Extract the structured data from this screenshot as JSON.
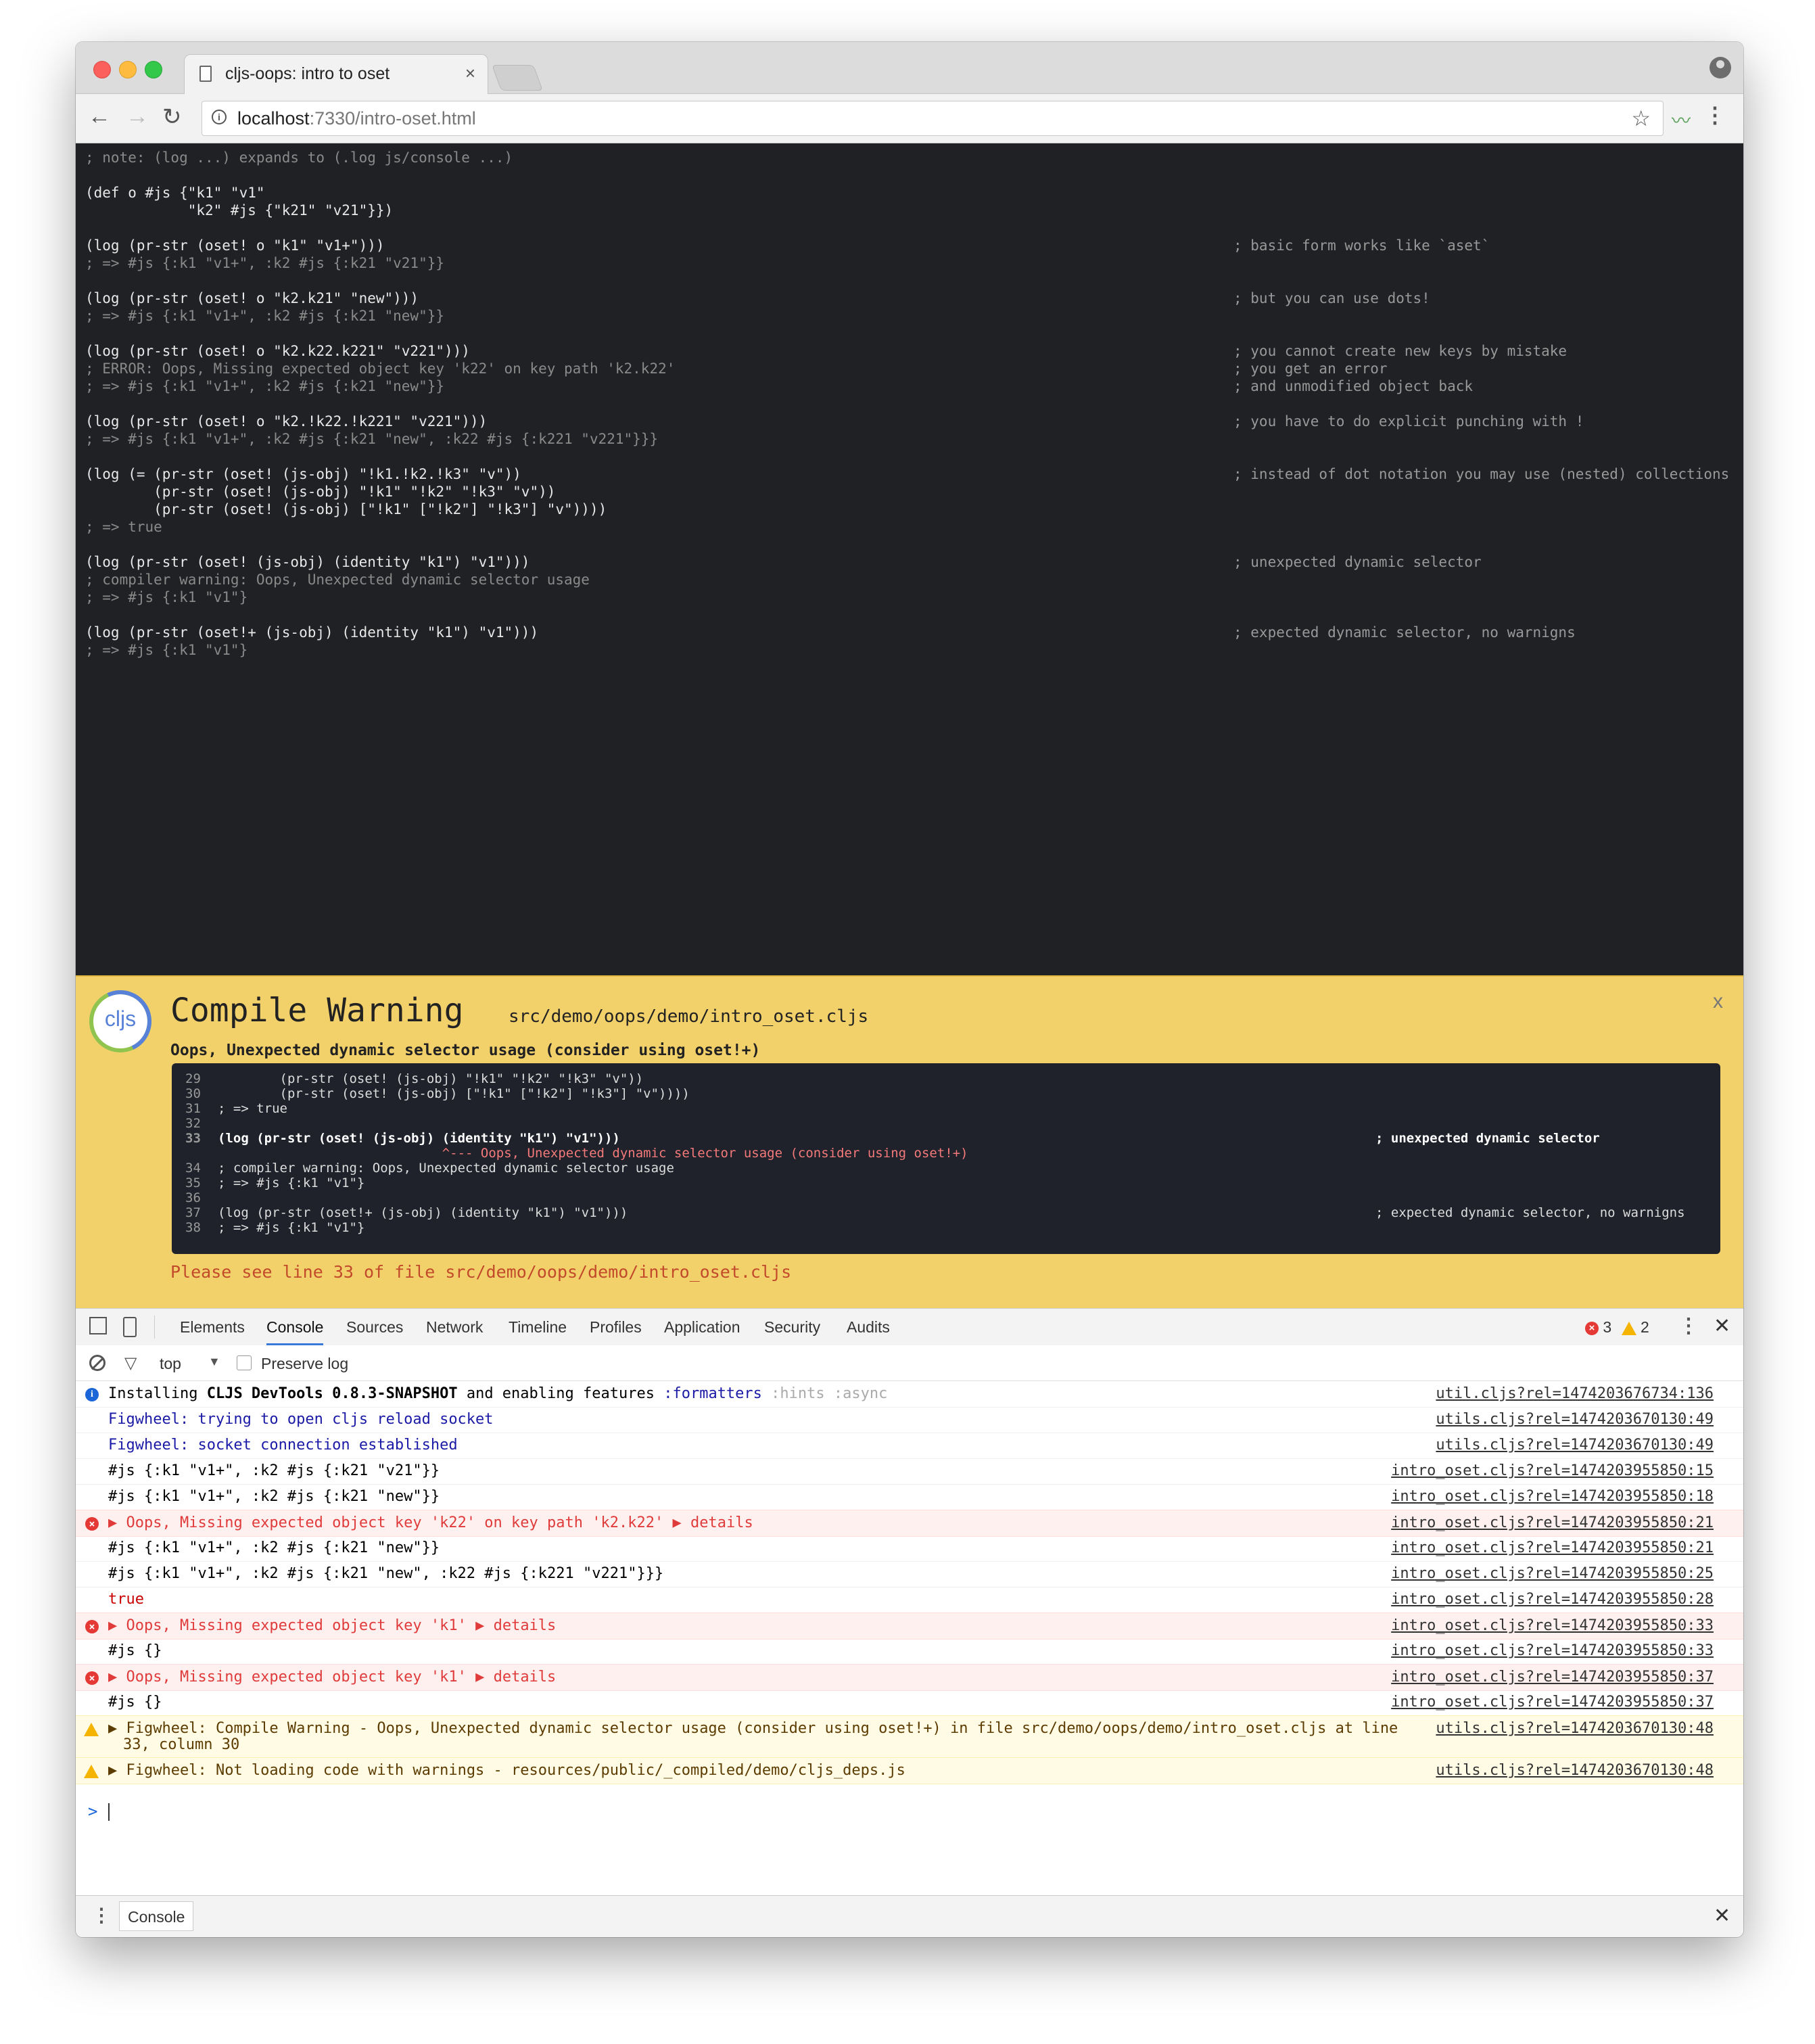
{
  "browser": {
    "tab_title": "cljs-oops: intro to oset",
    "tab_close": "×",
    "url_host": "localhost",
    "url_rest": ":7330/intro-oset.html"
  },
  "code": {
    "note": "; note: (log ...) expands to (.log js/console ...)",
    "blocks": [
      {
        "l1": "(def o #js {\"k1\" \"v1\"",
        "l2": "            \"k2\" #js {\"k21\" \"v21\"}})"
      },
      {
        "code": "(log (pr-str (oset! o \"k1\" \"v1+\")))",
        "result": "; => #js {:k1 \"v1+\", :k2 #js {:k21 \"v21\"}}",
        "comment": "; basic form works like `aset`"
      },
      {
        "code": "(log (pr-str (oset! o \"k2.k21\" \"new\")))",
        "result": "; => #js {:k1 \"v1+\", :k2 #js {:k21 \"new\"}}",
        "comment": "; but you can use dots!"
      },
      {
        "code": "(log (pr-str (oset! o \"k2.k22.k221\" \"v221\")))",
        "error": "; ERROR: Oops, Missing expected object key 'k22' on key path 'k2.k22'",
        "result": "; => #js {:k1 \"v1+\", :k2 #js {:k21 \"new\"}}",
        "c1": "; you cannot create new keys by mistake",
        "c2": "; you get an error",
        "c3": "; and unmodified object back"
      },
      {
        "code": "(log (pr-str (oset! o \"k2.!k22.!k221\" \"v221\")))",
        "result": "; => #js {:k1 \"v1+\", :k2 #js {:k21 \"new\", :k22 #js {:k221 \"v221\"}}}",
        "comment": "; you have to do explicit punching with !"
      },
      {
        "l1": "(log (= (pr-str (oset! (js-obj) \"!k1.!k2.!k3\" \"v\"))",
        "l2": "        (pr-str (oset! (js-obj) \"!k1\" \"!k2\" \"!k3\" \"v\"))",
        "l3": "        (pr-str (oset! (js-obj) [\"!k1\" [\"!k2\"] \"!k3\"] \"v\"))))",
        "result": "; => true",
        "comment": "; instead of dot notation you may use (nested) collections"
      },
      {
        "code": "(log (pr-str (oset! (js-obj) (identity \"k1\") \"v1\")))",
        "warn": "; compiler warning: Oops, Unexpected dynamic selector usage",
        "result": "; => #js {:k1 \"v1\"}",
        "comment": "; unexpected dynamic selector"
      },
      {
        "code": "(log (pr-str (oset!+ (js-obj) (identity \"k1\") \"v1\")))",
        "result": "; => #js {:k1 \"v1\"}",
        "comment": "; expected dynamic selector, no warnigns"
      }
    ]
  },
  "warning": {
    "logo_text": "cljs",
    "title": "Compile Warning",
    "file": "src/demo/oops/demo/intro_oset.cljs",
    "message": "Oops, Unexpected dynamic selector usage (consider using oset!+)",
    "close": "x",
    "lines": [
      {
        "n": "29",
        "t": "        (pr-str (oset! (js-obj) \"!k1\" \"!k2\" \"!k3\" \"v\"))",
        "c": ""
      },
      {
        "n": "30",
        "t": "        (pr-str (oset! (js-obj) [\"!k1\" [\"!k2\"] \"!k3\"] \"v\"))))",
        "c": ""
      },
      {
        "n": "31",
        "t": "; => true",
        "c": ""
      },
      {
        "n": "32",
        "t": "",
        "c": ""
      },
      {
        "n": "33",
        "t": "(log (pr-str (oset! (js-obj) (identity \"k1\") \"v1\")))",
        "c": "; unexpected dynamic selector"
      },
      {
        "n": "",
        "t": "                             ^--- Oops, Unexpected dynamic selector usage (consider using oset!+)",
        "c": ""
      },
      {
        "n": "34",
        "t": "; compiler warning: Oops, Unexpected dynamic selector usage",
        "c": ""
      },
      {
        "n": "35",
        "t": "; => #js {:k1 \"v1\"}",
        "c": ""
      },
      {
        "n": "36",
        "t": "",
        "c": ""
      },
      {
        "n": "37",
        "t": "(log (pr-str (oset!+ (js-obj) (identity \"k1\") \"v1\")))",
        "c": "; expected dynamic selector, no warnigns"
      },
      {
        "n": "38",
        "t": "; => #js {:k1 \"v1\"}",
        "c": ""
      }
    ],
    "footer": "Please see line 33 of file src/demo/oops/demo/intro_oset.cljs"
  },
  "devtools": {
    "tabs": [
      "Elements",
      "Console",
      "Sources",
      "Network",
      "Timeline",
      "Profiles",
      "Application",
      "Security",
      "Audits"
    ],
    "error_count": "3",
    "warning_count": "2",
    "context": "top",
    "preserve_log": "Preserve log",
    "drawer_tab": "Console",
    "messages": [
      {
        "type": "info",
        "text_a": "Installing ",
        "text_b": "CLJS DevTools 0.8.3-SNAPSHOT",
        "text_c": " and enabling features ",
        "text_d": ":formatters",
        "text_e": " :hints :async",
        "src": "util.cljs?rel=1474203676734:136"
      },
      {
        "type": "log-blue",
        "text": "Figwheel: trying to open cljs reload socket",
        "src": "utils.cljs?rel=1474203670130:49"
      },
      {
        "type": "log-blue",
        "text": "Figwheel: socket connection established",
        "src": "utils.cljs?rel=1474203670130:49"
      },
      {
        "type": "log",
        "text": "#js {:k1 \"v1+\", :k2 #js {:k21 \"v21\"}}",
        "src": "intro_oset.cljs?rel=1474203955850:15"
      },
      {
        "type": "log",
        "text": "#js {:k1 \"v1+\", :k2 #js {:k21 \"new\"}}",
        "src": "intro_oset.cljs?rel=1474203955850:18"
      },
      {
        "type": "error",
        "text": "Oops, Missing expected object key 'k22' on key path 'k2.k22'",
        "details": "details",
        "src": "intro_oset.cljs?rel=1474203955850:21"
      },
      {
        "type": "log",
        "text": "#js {:k1 \"v1+\", :k2 #js {:k21 \"new\"}}",
        "src": "intro_oset.cljs?rel=1474203955850:21"
      },
      {
        "type": "log",
        "text": "#js {:k1 \"v1+\", :k2 #js {:k21 \"new\", :k22 #js {:k221 \"v221\"}}}",
        "src": "intro_oset.cljs?rel=1474203955850:25"
      },
      {
        "type": "log-red",
        "text": "true",
        "src": "intro_oset.cljs?rel=1474203955850:28"
      },
      {
        "type": "error",
        "text": "Oops, Missing expected object key 'k1'",
        "details": "details",
        "src": "intro_oset.cljs?rel=1474203955850:33"
      },
      {
        "type": "log",
        "text": "#js {}",
        "src": "intro_oset.cljs?rel=1474203955850:33"
      },
      {
        "type": "error",
        "text": "Oops, Missing expected object key 'k1'",
        "details": "details",
        "src": "intro_oset.cljs?rel=1474203955850:37"
      },
      {
        "type": "log",
        "text": "#js {}",
        "src": "intro_oset.cljs?rel=1474203955850:37"
      },
      {
        "type": "warn",
        "text": "Figwheel: Compile Warning - Oops, Unexpected dynamic selector usage (consider using oset!+) in file src/demo/oops/demo/intro_oset.cljs at line",
        "text2": "33, column 30",
        "src": "utils.cljs?rel=1474203670130:48"
      },
      {
        "type": "warn",
        "text": "Figwheel: Not loading code with warnings - resources/public/_compiled/demo/cljs_deps.js",
        "src": "utils.cljs?rel=1474203670130:48"
      }
    ],
    "prompt": ">"
  }
}
